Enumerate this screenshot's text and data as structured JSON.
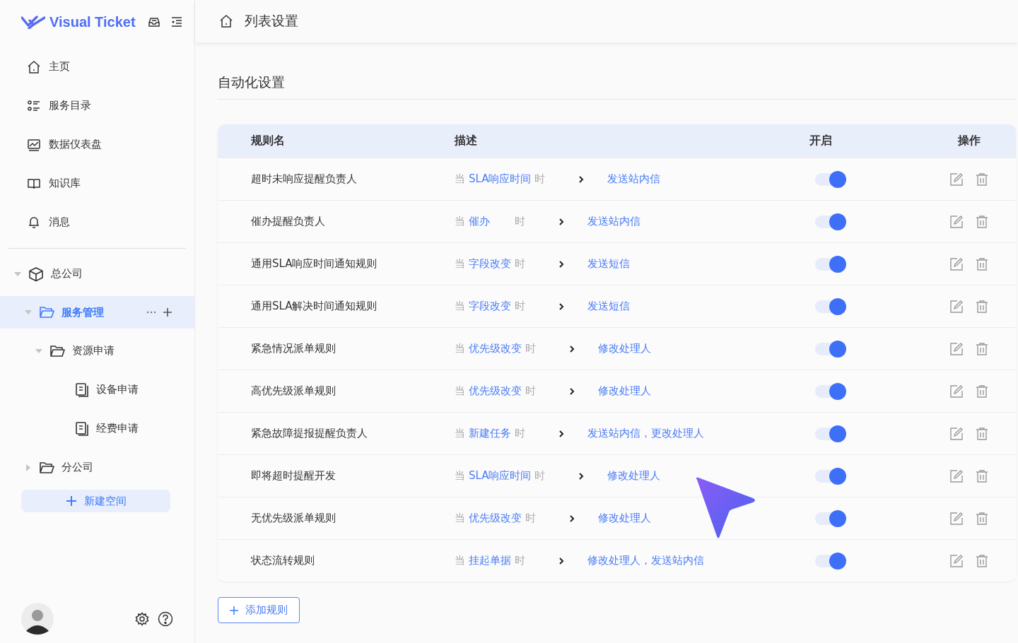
{
  "brand": {
    "name": "Visual Ticket"
  },
  "nav": [
    {
      "label": "主页",
      "selected": false
    },
    {
      "label": "服务目录",
      "selected": false
    },
    {
      "label": "数据仪表盘",
      "selected": false
    },
    {
      "label": "知识库",
      "selected": false
    },
    {
      "label": "消息",
      "selected": false
    }
  ],
  "tree": [
    {
      "label": "总公司",
      "expanded": true,
      "selected": false,
      "children": [
        {
          "label": "服务管理",
          "expanded": true,
          "selected": true,
          "children": [
            {
              "label": "资源申请",
              "expanded": true,
              "selected": false,
              "children": [
                {
                  "label": "设备申请",
                  "selected": false
                },
                {
                  "label": "经费申请",
                  "selected": false
                }
              ]
            }
          ]
        },
        {
          "label": "分公司",
          "expanded": false,
          "selected": false
        }
      ]
    }
  ],
  "new_space_button": "新建空间",
  "header": {
    "title": "列表设置"
  },
  "section": {
    "title": "自动化设置"
  },
  "table": {
    "columns": [
      "规则名",
      "描述",
      "开启",
      "操作"
    ],
    "rows": [
      {
        "name": "超时未响应提醒负责人",
        "when": "当",
        "trigger": "SLA响应时间",
        "then": "时",
        "action": "发送站内信",
        "on": true
      },
      {
        "name": "催办提醒负责人",
        "when": "当",
        "trigger": "催办",
        "then": "时",
        "action": "发送站内信",
        "on": true
      },
      {
        "name": "通用SLA响应时间通知规则",
        "when": "当",
        "trigger": "字段改变",
        "then": "时",
        "action": "发送短信",
        "on": true
      },
      {
        "name": "通用SLA解决时间通知规则",
        "when": "当",
        "trigger": "字段改变",
        "then": "时",
        "action": "发送短信",
        "on": true
      },
      {
        "name": "紧急情况派单规则",
        "when": "当",
        "trigger": "优先级改变",
        "then": "时",
        "action": "修改处理人",
        "on": true
      },
      {
        "name": "高优先级派单规则",
        "when": "当",
        "trigger": "优先级改变",
        "then": "时",
        "action": "修改处理人",
        "on": true
      },
      {
        "name": "紧急故障提报提醒负责人",
        "when": "当",
        "trigger": "新建任务",
        "then": "时",
        "action": "发送站内信，更改处理人",
        "on": true
      },
      {
        "name": "即将超时提醒开发",
        "when": "当",
        "trigger": "SLA响应时间",
        "then": "时",
        "action": "修改处理人",
        "on": true
      },
      {
        "name": "无优先级派单规则",
        "when": "当",
        "trigger": "优先级改变",
        "then": "时",
        "action": "修改处理人",
        "on": true
      },
      {
        "name": "状态流转规则",
        "when": "当",
        "trigger": "挂起单据",
        "then": "时",
        "action": "修改处理人，发送站内信",
        "on": true
      }
    ]
  },
  "add_rule_button": "添加规则"
}
